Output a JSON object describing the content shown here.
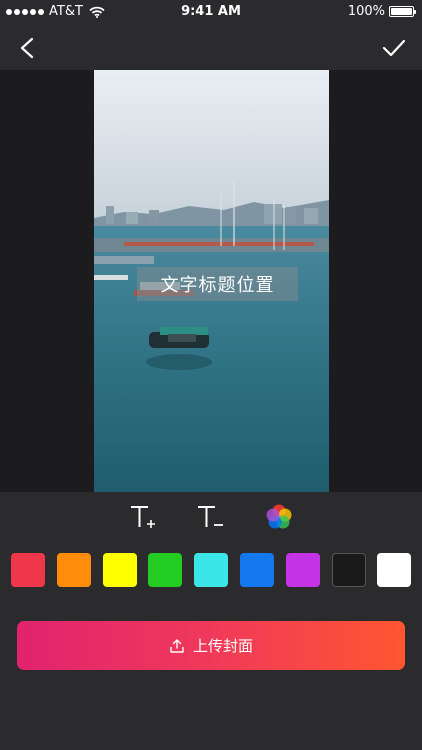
{
  "status": {
    "carrier": "AT&T",
    "time": "9:41 AM",
    "battery": "100%"
  },
  "nav": {
    "back_icon": "chevron-left-icon",
    "confirm_icon": "checkmark-icon"
  },
  "preview": {
    "title_text": "文字标题位置"
  },
  "tools": {
    "increase_icon": "text-size-increase-icon",
    "decrease_icon": "text-size-decrease-icon",
    "color_icon": "color-palette-icon"
  },
  "palette": [
    {
      "name": "red",
      "color": "#f0364a"
    },
    {
      "name": "orange",
      "color": "#ff8c0a"
    },
    {
      "name": "yellow",
      "color": "#ffff00"
    },
    {
      "name": "green",
      "color": "#22cc22"
    },
    {
      "name": "cyan",
      "color": "#3ce6e6"
    },
    {
      "name": "blue",
      "color": "#1478f0"
    },
    {
      "name": "purple",
      "color": "#c433e6"
    },
    {
      "name": "black",
      "color": "#1a1a1a"
    },
    {
      "name": "white",
      "color": "#ffffff"
    }
  ],
  "upload": {
    "label": "上传封面",
    "icon": "upload-icon"
  }
}
